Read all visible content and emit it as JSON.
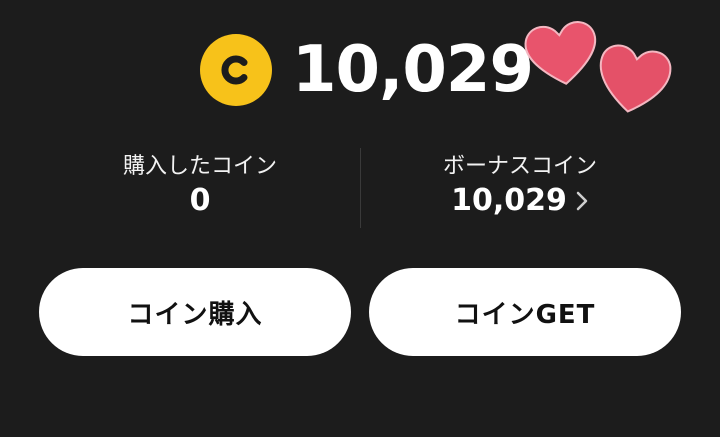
{
  "balance": {
    "coin_icon": "coin-c-icon",
    "total": "10,029",
    "decoration": "hearts-sticker"
  },
  "breakdown": {
    "purchased": {
      "label": "購入したコイン",
      "value": "0"
    },
    "bonus": {
      "label": "ボーナスコイン",
      "value": "10,029",
      "icon": "chevron-right-icon"
    }
  },
  "buttons": {
    "buy_label": "コイン購入",
    "get_label": "コインGET"
  },
  "colors": {
    "background": "#1c1c1c",
    "coin": "#f7c21a",
    "heart": "#e8546c",
    "button": "#ffffff",
    "button_text": "#111111"
  }
}
